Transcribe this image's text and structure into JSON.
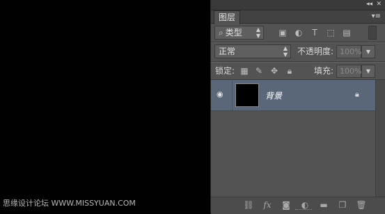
{
  "panel": {
    "tab_label": "图层",
    "filter": {
      "label": "类型",
      "search_glyph": "⌕"
    },
    "blend_mode": {
      "value": "正常"
    },
    "opacity": {
      "label": "不透明度:",
      "value": "100%"
    },
    "lock": {
      "label": "锁定:"
    },
    "fill": {
      "label": "填充:",
      "value": "100%"
    },
    "layers": [
      {
        "name": "背景",
        "visible": true,
        "locked": true
      }
    ]
  },
  "watermark": {
    "text": "思缘设计论坛 WWW.MISSYUAN.COM"
  }
}
